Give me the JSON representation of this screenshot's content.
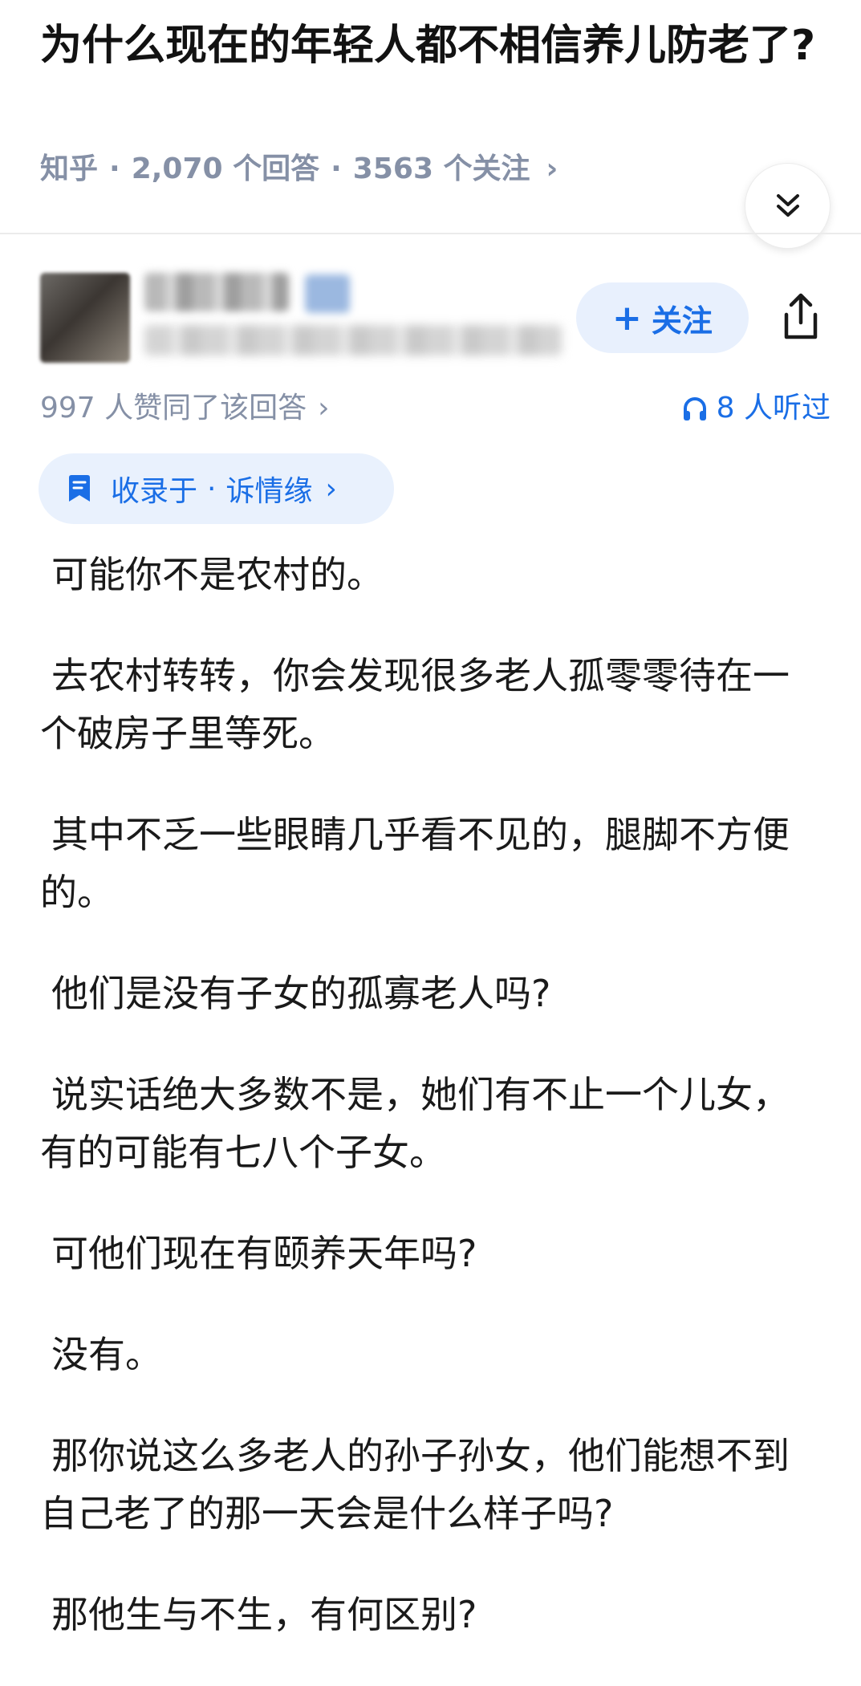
{
  "question": {
    "title": "为什么现在的年轻人都不相信养儿防老了?",
    "source": "知乎",
    "answers_count": "2,070 个回答",
    "followers_count": "3563 个关注",
    "chevron": "›"
  },
  "author": {
    "follow_label": "关注",
    "follow_plus": "+"
  },
  "stats": {
    "likes": "997 人赞同了该回答",
    "chevron": "›",
    "listened": "8 人听过"
  },
  "collection": {
    "prefix": "收录于",
    "dot": "·",
    "name": "诉情缘",
    "chevron": "›"
  },
  "answer": {
    "paragraphs": [
      "可能你不是农村的。",
      "去农村转转，你会发现很多老人孤零零待在一个破房子里等死。",
      "其中不乏一些眼睛几乎看不见的，腿脚不方便的。",
      "他们是没有子女的孤寡老人吗?",
      "说实话绝大多数不是，她们有不止一个儿女，有的可能有七八个子女。",
      "可他们现在有颐养天年吗?",
      "没有。",
      "那你说这么多老人的孙子孙女，他们能想不到自己老了的那一天会是什么样子吗?",
      "那他生与不生，有何区别?"
    ]
  },
  "colors": {
    "accent": "#1a6ee6",
    "meta_gray": "#8590a6",
    "chip_bg": "#e9f1fd"
  },
  "icons": {
    "expand": "double-chevron-down-icon",
    "share": "share-icon",
    "listen": "headphones-icon",
    "collection": "bookmark-icon"
  }
}
